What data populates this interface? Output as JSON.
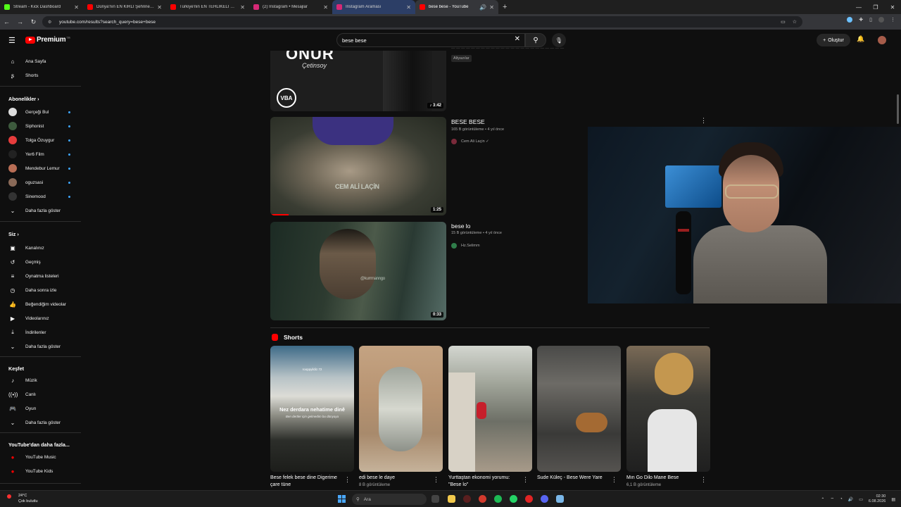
{
  "browser": {
    "tabs": [
      {
        "label": "Stream - Kick Dashboard",
        "color": "#53fc18"
      },
      {
        "label": "Dünya'nın EN KİRLİ Şehrine Gi...",
        "color": "#ff0000"
      },
      {
        "label": "Türkiye'nin EN TEHLİKELİ Roma...",
        "color": "#ff0000"
      },
      {
        "label": "(2) Instagram • Mesajlar",
        "color": "#d62976"
      },
      {
        "label": "Instagram Araması",
        "color": "#d62976"
      },
      {
        "label": "bese bese - YouTube",
        "color": "#ff0000"
      }
    ],
    "url": "youtube.com/results?search_query=bese+bese"
  },
  "masthead": {
    "logo_text": "Premium",
    "logo_sup": "TR",
    "search_value": "bese bese",
    "create_label": "Oluştur"
  },
  "sidebar": {
    "home": "Ana Sayfa",
    "shorts": "Shorts",
    "subs_header": "Abonelikler",
    "channels": [
      {
        "name": "Gerçeği Bul",
        "color": "#dddddd"
      },
      {
        "name": "Siphonist",
        "color": "#3d5a3d"
      },
      {
        "name": "Tolga Özuygur",
        "color": "#e63c3c"
      },
      {
        "name": "Yer6 Film",
        "color": "#222222"
      },
      {
        "name": "Mendebur Lemur",
        "color": "#b96e55"
      },
      {
        "name": "oguzsasi",
        "color": "#8a6a58"
      },
      {
        "name": "Sinemood",
        "color": "#333333"
      }
    ],
    "show_more_1": "Daha fazla göster",
    "you_header": "Siz",
    "you_items": [
      "Kanalınız",
      "Geçmiş",
      "Oynatma listeleri",
      "Daha sonra izle",
      "Beğendiğim videolar",
      "Videolarınız",
      "İndirilenler",
      "Daha fazla göster"
    ],
    "explore_header": "Keşfet",
    "explore_items": [
      "Müzik",
      "Canlı",
      "Oyun",
      "Daha fazla göster"
    ],
    "more_header": "YouTube'dan daha fazla...",
    "more_items": [
      "YouTube Music",
      "YouTube Kids"
    ]
  },
  "results": {
    "top": {
      "overlay_1": "ONUR",
      "overlay_2": "Çetinsoy",
      "logo": "VBA",
      "duration": "3:42",
      "chip": "Altyazılar"
    },
    "videos": [
      {
        "title": "BESE BESE",
        "meta": "165 B görüntüleme • 4 yıl önce",
        "channel": "Cem Ali Laçin ✓",
        "duration": "1:25",
        "overlay": "CEM ALİ LAÇİN"
      },
      {
        "title": "bese lo",
        "meta": "15 B görüntüleme • 4 yıl önce",
        "channel": "Hz.Selimm",
        "duration": "0:33",
        "overlay": "@kurrmanngo"
      }
    ]
  },
  "shorts": {
    "header": "Shorts",
    "items": [
      {
        "title": "Bese felek bese dine Digerime çare tüne",
        "views": "",
        "overlay": "Nez derdara nehatime dinê",
        "sub": "Ben dertler için gelmedim bu dünyaya",
        "handle": "rooppyildiz.72"
      },
      {
        "title": "edi bese le daye",
        "views": "8 B görüntüleme"
      },
      {
        "title": "Yurttaştan ekonomi yorumu: \"Bese lo\"",
        "views": ""
      },
      {
        "title": "Sude Küleç - Bese Were Yare",
        "views": ""
      },
      {
        "title": "Mın Go Dilo Mane Bese",
        "views": "6,1 B görüntüleme"
      }
    ]
  },
  "taskbar": {
    "weather_temp": "24°C",
    "weather_desc": "Çok bulutlu",
    "search_placeholder": "Ara",
    "time": "02:30",
    "date": "6.08.2026"
  }
}
